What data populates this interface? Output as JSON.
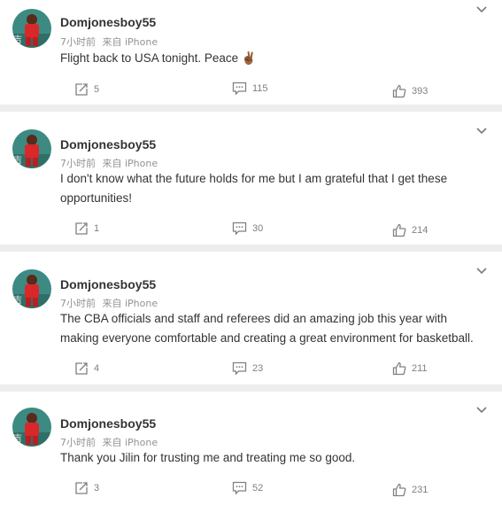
{
  "posts": [
    {
      "author": "Domjonesboy55",
      "time": "7小时前",
      "source": "来自 iPhone",
      "text": "Flight back to USA tonight. Peace ✌🏾",
      "reposts": "5",
      "comments": "115",
      "likes": "393"
    },
    {
      "author": "Domjonesboy55",
      "time": "7小时前",
      "source": "来自 iPhone",
      "text": "I don't know what the future holds for me but I am grateful that I get these opportunities!",
      "reposts": "1",
      "comments": "30",
      "likes": "214"
    },
    {
      "author": "Domjonesboy55",
      "time": "7小时前",
      "source": "来自 iPhone",
      "text": "The CBA officials and staff and referees did an amazing job this year with making everyone comfortable and creating a great environment for basketball.",
      "reposts": "4",
      "comments": "23",
      "likes": "211"
    },
    {
      "author": "Domjonesboy55",
      "time": "7小时前",
      "source": "来自 iPhone",
      "text": "Thank you Jilin for trusting me and treating me so good.",
      "reposts": "3",
      "comments": "52",
      "likes": "231"
    }
  ],
  "icons": {
    "avatar": "user-avatar",
    "menu": "chevron-down-icon",
    "repost": "share-icon",
    "comment": "comment-icon",
    "like": "thumbs-up-icon"
  },
  "colors": {
    "page_bg": "#ededed",
    "card_bg": "#ffffff",
    "text": "#333333",
    "meta": "#939393",
    "icon": "#808080"
  }
}
